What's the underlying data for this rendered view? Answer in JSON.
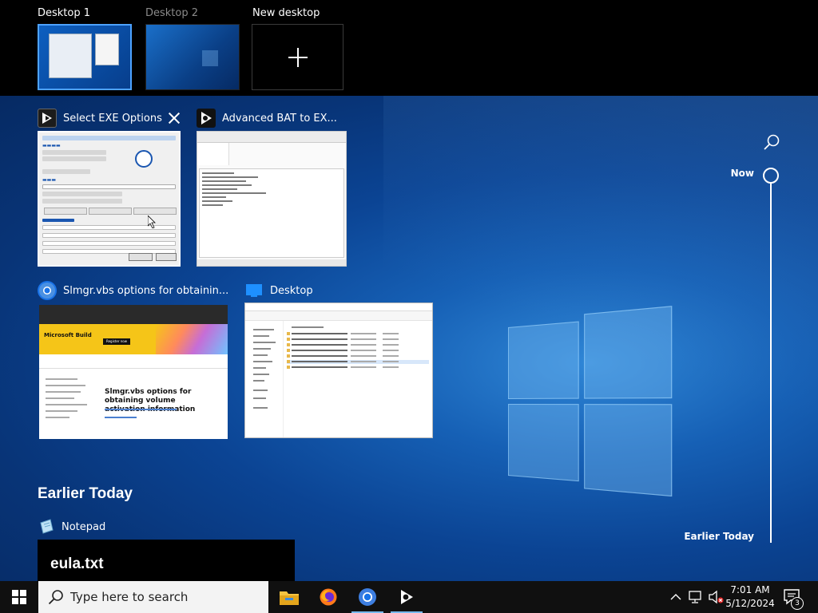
{
  "desktops": {
    "desktop1_label": "Desktop 1",
    "desktop2_label": "Desktop 2",
    "new_label": "New desktop"
  },
  "windows": [
    {
      "title": "Select EXE Options"
    },
    {
      "title": "Advanced BAT to EX..."
    },
    {
      "title": "Slmgr.vbs options for obtainin..."
    },
    {
      "title": "Desktop"
    }
  ],
  "browser_preview": {
    "banner_title": "Microsoft Build",
    "banner_button": "Register now",
    "heading": "Slmgr.vbs options for obtaining volume activation information"
  },
  "earlier": {
    "section_title": "Earlier Today",
    "app_name": "Notepad",
    "file_name": "eula.txt"
  },
  "timeline": {
    "now_label": "Now",
    "earlier_label": "Earlier Today"
  },
  "taskbar": {
    "search_placeholder": "Type here to search",
    "time": "7:01 AM",
    "date": "5/12/2024",
    "notification_count": "3"
  },
  "colors": {
    "accent": "#4da2ff",
    "taskbar": "#101010",
    "search_box": "#f3f3f3"
  }
}
